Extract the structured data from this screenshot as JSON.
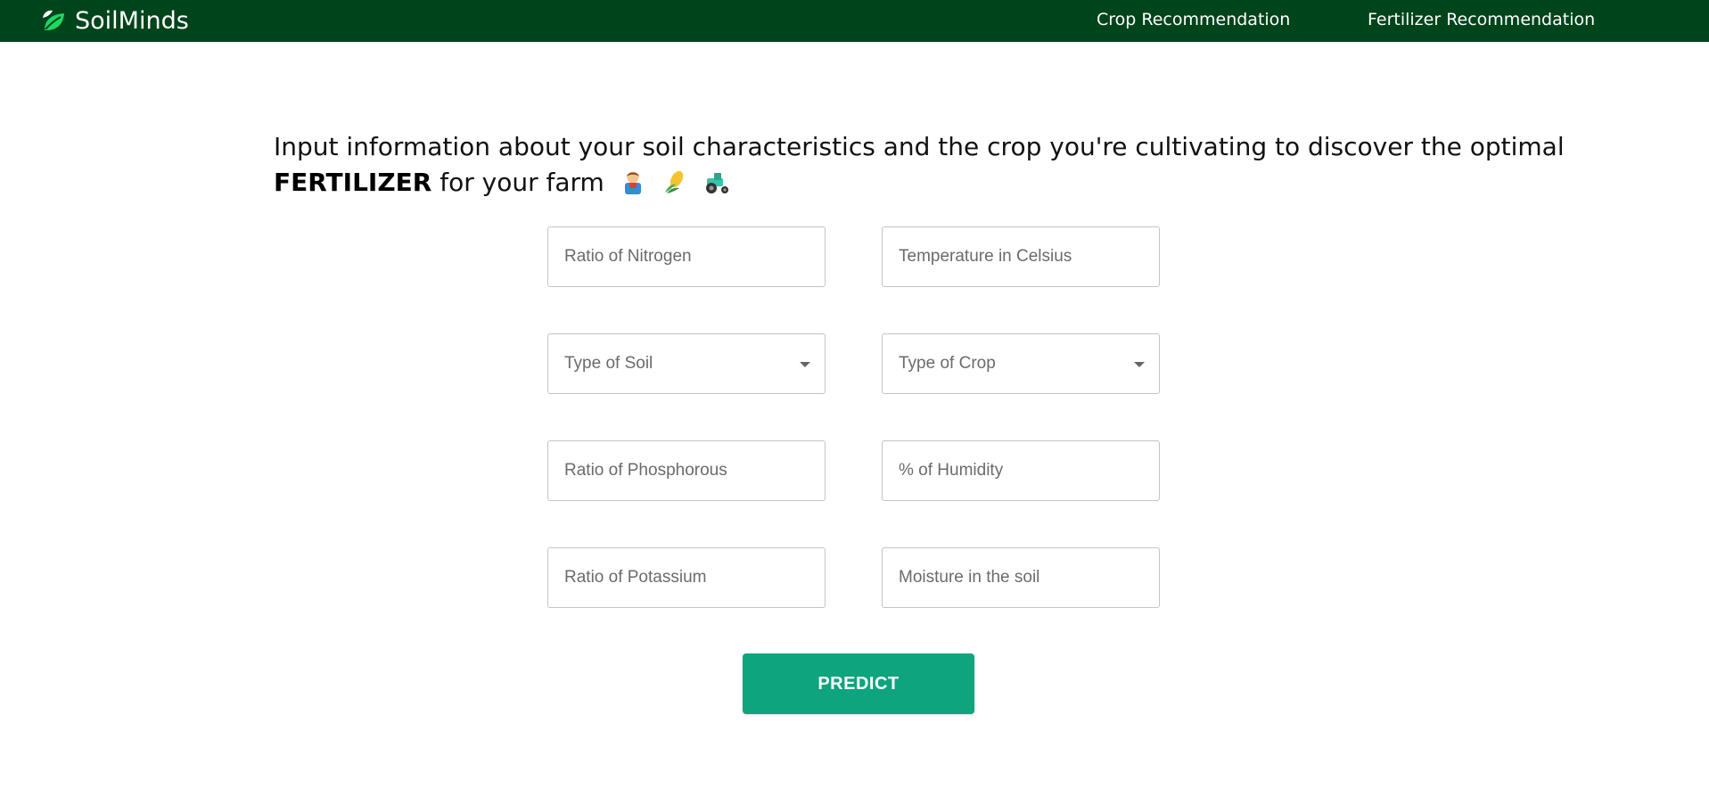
{
  "nav": {
    "brand": "SoilMinds",
    "links": [
      "Crop Recommendation",
      "Fertilizer Recommendation"
    ]
  },
  "intro": {
    "text_before": "Input information about your soil characteristics and the crop you're cultivating to discover the optimal ",
    "highlight": "FERTILIZER",
    "text_after": " for your farm",
    "emojis": [
      "farmer-icon",
      "corn-icon",
      "tractor-icon"
    ]
  },
  "form": {
    "nitrogen_placeholder": "Ratio of Nitrogen",
    "temperature_placeholder": "Temperature in Celsius",
    "soil_type_label": "Type of Soil",
    "crop_type_label": "Type of Crop",
    "phosphorous_placeholder": "Ratio of Phosphorous",
    "humidity_placeholder": "% of Humidity",
    "potassium_placeholder": "Ratio of Potassium",
    "moisture_placeholder": "Moisture in the soil"
  },
  "predict_label": "PREDICT",
  "colors": {
    "navbar": "#00441b",
    "logo_leaf": "#1ed760",
    "predict_button": "#0da47e"
  }
}
